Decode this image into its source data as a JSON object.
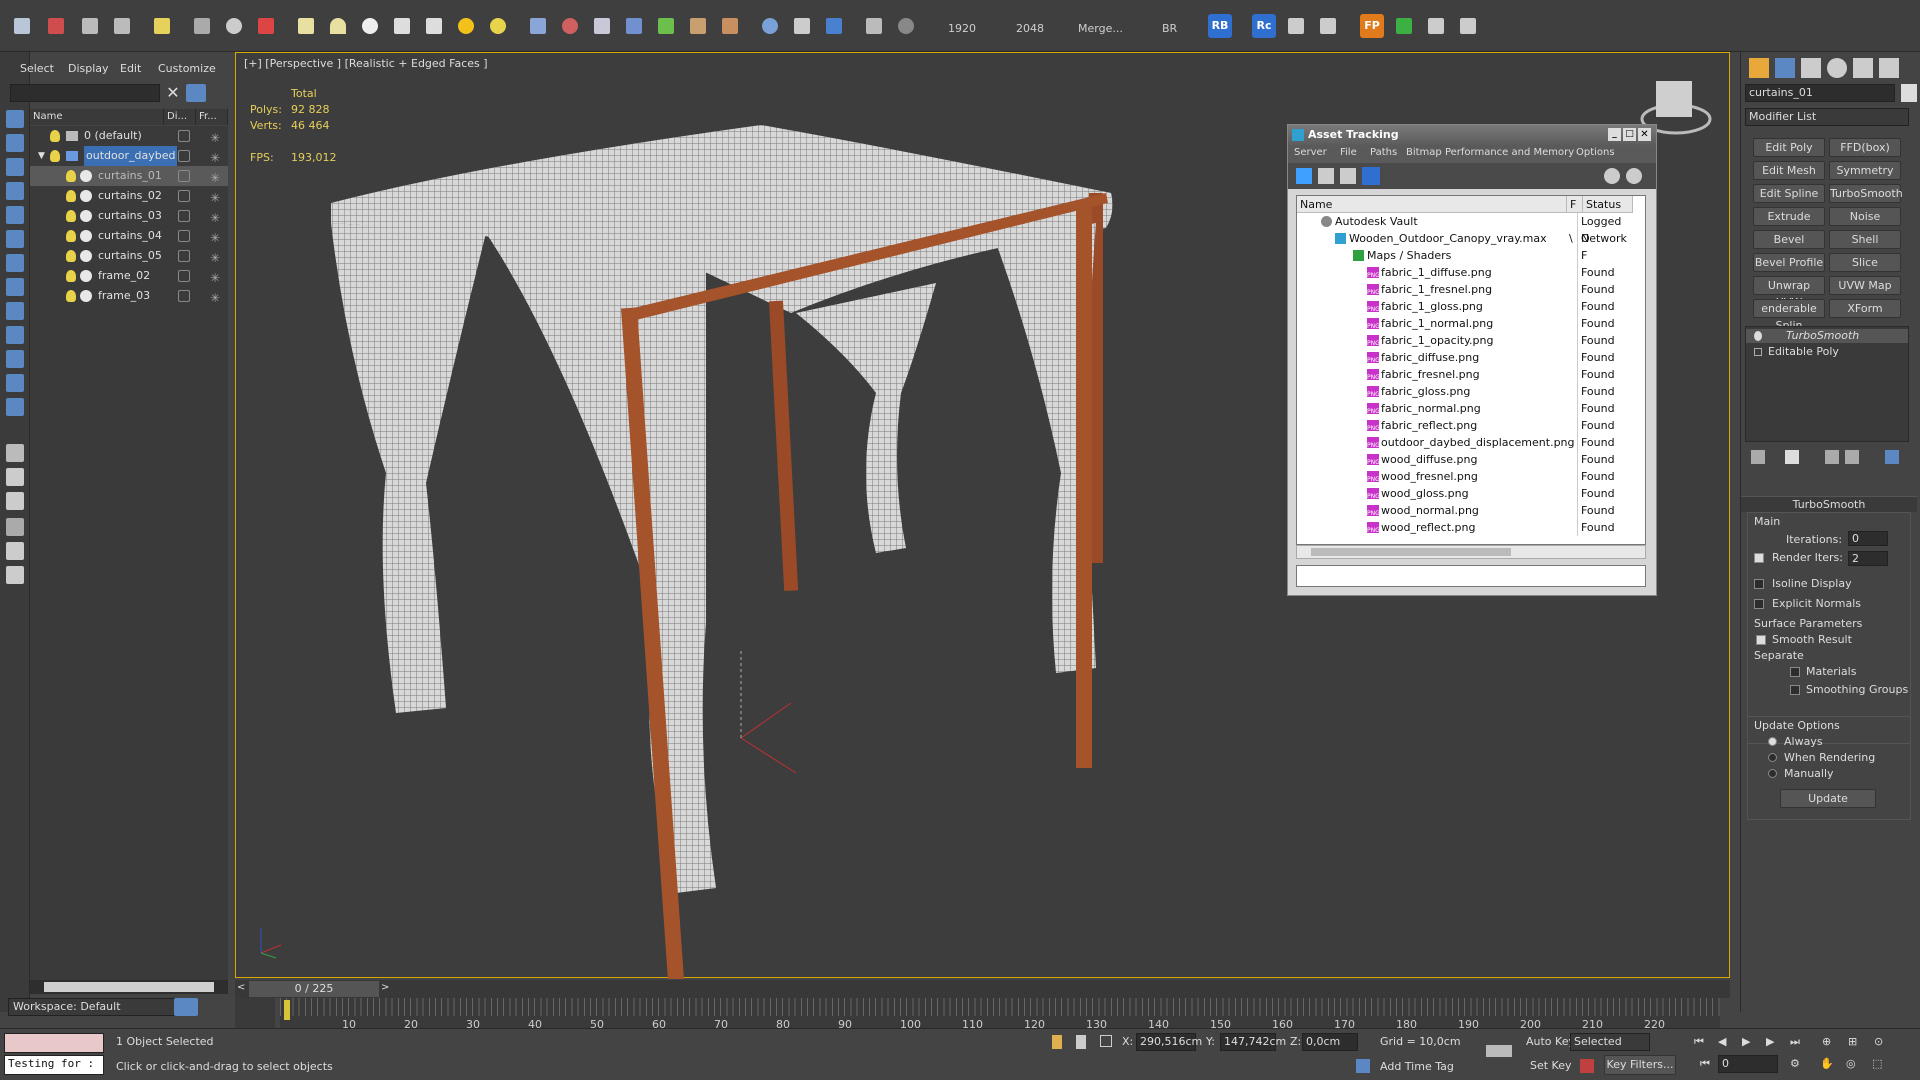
{
  "toolbar": {
    "res_w": "1920",
    "res_h": "2048",
    "merge": "Merge...",
    "br": "BR",
    "rb": "RB",
    "rc": "Rc",
    "fp": "FP"
  },
  "explorer": {
    "menu": [
      "Select",
      "Display",
      "Edit",
      "Customize"
    ],
    "cols": [
      "Name",
      "Di...",
      "Fr..."
    ],
    "items": [
      "0 (default)",
      "outdoor_daybed",
      "curtains_01",
      "curtains_02",
      "curtains_03",
      "curtains_04",
      "curtains_05",
      "frame_02",
      "frame_03"
    ]
  },
  "workspace": "Workspace: Default",
  "viewport": {
    "label": "[+] [Perspective ] [Realistic + Edged Faces ]",
    "total": "Total",
    "polys_lbl": "Polys:",
    "polys": "92 828",
    "verts_lbl": "Verts:",
    "verts": "46 464",
    "fps_lbl": "FPS:",
    "fps": "193,012"
  },
  "asset": {
    "title": "Asset Tracking",
    "menu": [
      "Server",
      "File",
      "Paths",
      "Bitmap Performance and Memory",
      "Options"
    ],
    "cols": [
      "Name",
      "F",
      "Status"
    ],
    "vault": "Autodesk Vault",
    "vault_status": "Logged O",
    "file": "Wooden_Outdoor_Canopy_vray.max",
    "file_flag": "\\",
    "file_status": "Network F",
    "maps": "Maps / Shaders",
    "items": [
      "fabric_1_diffuse.png",
      "fabric_1_fresnel.png",
      "fabric_1_gloss.png",
      "fabric_1_normal.png",
      "fabric_1_opacity.png",
      "fabric_diffuse.png",
      "fabric_fresnel.png",
      "fabric_gloss.png",
      "fabric_normal.png",
      "fabric_reflect.png",
      "outdoor_daybed_displacement.png",
      "wood_diffuse.png",
      "wood_fresnel.png",
      "wood_gloss.png",
      "wood_normal.png",
      "wood_reflect.png"
    ],
    "found": "Found",
    "png": "PNG"
  },
  "panel": {
    "object": "curtains_01",
    "modlist": "Modifier List",
    "buttons": [
      "Edit Poly",
      "FFD(box)",
      "Edit Mesh",
      "Symmetry",
      "Edit Spline",
      "TurboSmooth",
      "Extrude",
      "Noise",
      "Bevel",
      "Shell",
      "Bevel Profile",
      "Slice",
      "Unwrap UVW",
      "UVW Map",
      "enderable Splin",
      "XForm"
    ],
    "stack": [
      "TurboSmooth",
      "Editable Poly"
    ],
    "roll": "TurboSmooth",
    "main": "Main",
    "iter_lbl": "Iterations:",
    "iter": "0",
    "render_lbl": "Render Iters:",
    "render": "2",
    "isoline": "Isoline Display",
    "explicit": "Explicit Normals",
    "surface": "Surface Parameters",
    "smooth": "Smooth Result",
    "separate": "Separate",
    "materials": "Materials",
    "groups": "Smoothing Groups",
    "update_opts": "Update Options",
    "always": "Always",
    "when": "When Rendering",
    "manually": "Manually",
    "update": "Update"
  },
  "timeline": {
    "frame": "0 / 225",
    "ticks": [
      "10",
      "20",
      "30",
      "40",
      "50",
      "60",
      "70",
      "80",
      "90",
      "100",
      "110",
      "120",
      "130",
      "140",
      "150",
      "160",
      "170",
      "180",
      "190",
      "200",
      "210",
      "220"
    ]
  },
  "status": {
    "script": "Testing for :",
    "selected": "1 Object Selected",
    "hint": "Click or click-and-drag to select objects",
    "x_lbl": "X:",
    "x": "290,516cm",
    "y_lbl": "Y:",
    "y": "147,742cm",
    "z_lbl": "Z:",
    "z": "0,0cm",
    "grid": "Grid = 10,0cm",
    "addtime": "Add Time Tag",
    "autokey": "Auto Key",
    "setkey": "Set Key",
    "selmode": "Selected",
    "filters": "Key Filters...",
    "frame": "0"
  }
}
